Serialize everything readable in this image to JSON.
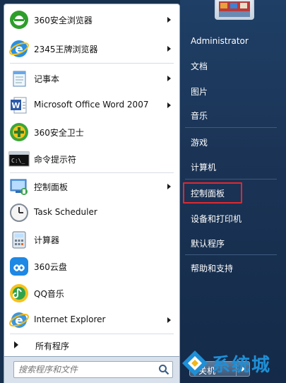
{
  "left_panel": {
    "items": [
      {
        "label": "360安全浏览器",
        "icon": "browser-360-icon",
        "has_arrow": true
      },
      {
        "label": "2345王牌浏览器",
        "icon": "ie-blue-icon",
        "has_arrow": true
      },
      {
        "label": "记事本",
        "icon": "notepad-icon",
        "has_arrow": true
      },
      {
        "label": "Microsoft Office Word 2007",
        "icon": "word-icon",
        "has_arrow": true
      },
      {
        "label": "360安全卫士",
        "icon": "shield-360-icon",
        "has_arrow": false
      },
      {
        "label": "命令提示符",
        "icon": "cmd-icon",
        "has_arrow": false
      },
      {
        "label": "控制面板",
        "icon": "control-panel-icon",
        "has_arrow": true
      },
      {
        "label": "Task Scheduler",
        "icon": "clock-icon",
        "has_arrow": false
      },
      {
        "label": "计算器",
        "icon": "calculator-icon",
        "has_arrow": false
      },
      {
        "label": "360云盘",
        "icon": "cloud-icon",
        "has_arrow": false
      },
      {
        "label": "QQ音乐",
        "icon": "qq-music-icon",
        "has_arrow": false
      },
      {
        "label": "Internet Explorer",
        "icon": "ie-icon",
        "has_arrow": true
      }
    ],
    "all_programs": "所有程序"
  },
  "search": {
    "placeholder": "搜索程序和文件"
  },
  "right_panel": {
    "items": [
      {
        "label": "Administrator"
      },
      {
        "label": "文档"
      },
      {
        "label": "图片"
      },
      {
        "label": "音乐"
      },
      {
        "label": "游戏"
      },
      {
        "label": "计算机"
      },
      {
        "label": "控制面板"
      },
      {
        "label": "设备和打印机"
      },
      {
        "label": "默认程序"
      },
      {
        "label": "帮助和支持"
      }
    ],
    "shutdown_label": "关机",
    "highlighted": "控制面板"
  },
  "watermark": {
    "text": "系统城"
  },
  "colors": {
    "highlight": "#e0282f",
    "panel_dark": "#1b3456"
  }
}
